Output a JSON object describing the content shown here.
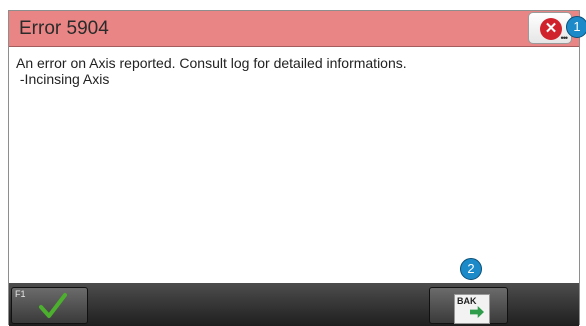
{
  "dialog": {
    "title": "Error 5904",
    "close_icon": "close-circle-icon",
    "message_lines": [
      "An error on Axis reported. Consult log for detailed informations.",
      " -Incinsing Axis"
    ]
  },
  "toolbar": {
    "ok_key_label": "F1",
    "ok_icon": "checkmark-icon",
    "bak_label": "BAK",
    "bak_icon": "backup-export-icon"
  },
  "callouts": [
    "1",
    "2"
  ],
  "colors": {
    "titlebar": "#e98585",
    "close_icon": "#d0222c",
    "checkmark": "#4caf2e",
    "callout": "#1c8ac8",
    "toolbar": "#2e2e2e"
  }
}
